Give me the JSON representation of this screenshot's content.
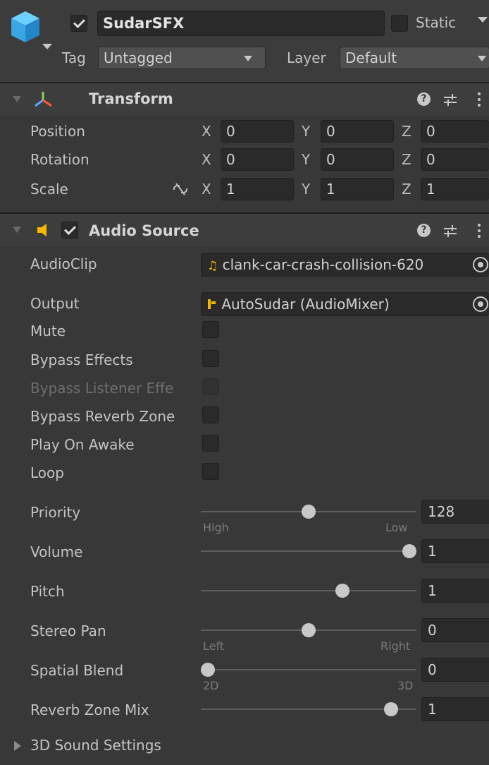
{
  "gameobject": {
    "name": "SudarSFX",
    "active": true,
    "static_label": "Static",
    "static_checked": false,
    "tag_label": "Tag",
    "tag_value": "Untagged",
    "layer_label": "Layer",
    "layer_value": "Default"
  },
  "transform": {
    "title": "Transform",
    "rows": [
      {
        "label": "Position",
        "x": "0",
        "y": "0",
        "z": "0"
      },
      {
        "label": "Rotation",
        "x": "0",
        "y": "0",
        "z": "0"
      },
      {
        "label": "Scale",
        "x": "1",
        "y": "1",
        "z": "1"
      }
    ],
    "axis_x": "X",
    "axis_y": "Y",
    "axis_z": "Z"
  },
  "audio_source": {
    "title": "Audio Source",
    "enabled": true,
    "audioclip_label": "AudioClip",
    "audioclip_value": "clank-car-crash-collision-620",
    "output_label": "Output",
    "output_value": "AutoSudar (AudioMixer)",
    "toggles": [
      {
        "label": "Mute",
        "checked": false,
        "disabled": false
      },
      {
        "label": "Bypass Effects",
        "checked": false,
        "disabled": false
      },
      {
        "label": "Bypass Listener Effe",
        "checked": false,
        "disabled": true
      },
      {
        "label": "Bypass Reverb Zone",
        "checked": false,
        "disabled": false
      },
      {
        "label": "Play On Awake",
        "checked": false,
        "disabled": false
      },
      {
        "label": "Loop",
        "checked": false,
        "disabled": false
      }
    ],
    "sliders": [
      {
        "label": "Priority",
        "value": "128",
        "fraction": 0.5,
        "left": "High",
        "right": "Low"
      },
      {
        "label": "Volume",
        "value": "1",
        "fraction": 1.0,
        "left": "",
        "right": ""
      },
      {
        "label": "Pitch",
        "value": "1",
        "fraction": 0.667,
        "left": "",
        "right": ""
      },
      {
        "label": "Stereo Pan",
        "value": "0",
        "fraction": 0.5,
        "left": "Left",
        "right": "Right"
      },
      {
        "label": "Spatial Blend",
        "value": "0",
        "fraction": 0.0,
        "left": "2D",
        "right": "3D"
      },
      {
        "label": "Reverb Zone Mix",
        "value": "1",
        "fraction": 0.909,
        "left": "",
        "right": ""
      }
    ],
    "sound_settings_label": "3D Sound Settings"
  },
  "colors": {
    "panel_bg": "#383838",
    "header_bg": "#3d3d3d",
    "field_bg": "#2a2a2a",
    "audio_icon": "#f5b800"
  },
  "icons": [
    "gameobject-cube-icon",
    "transform-icon",
    "audio-source-icon",
    "help-icon",
    "preset-icon",
    "kebab-menu-icon",
    "unlink-icon",
    "music-note-icon",
    "mixer-icon",
    "object-picker-icon"
  ]
}
